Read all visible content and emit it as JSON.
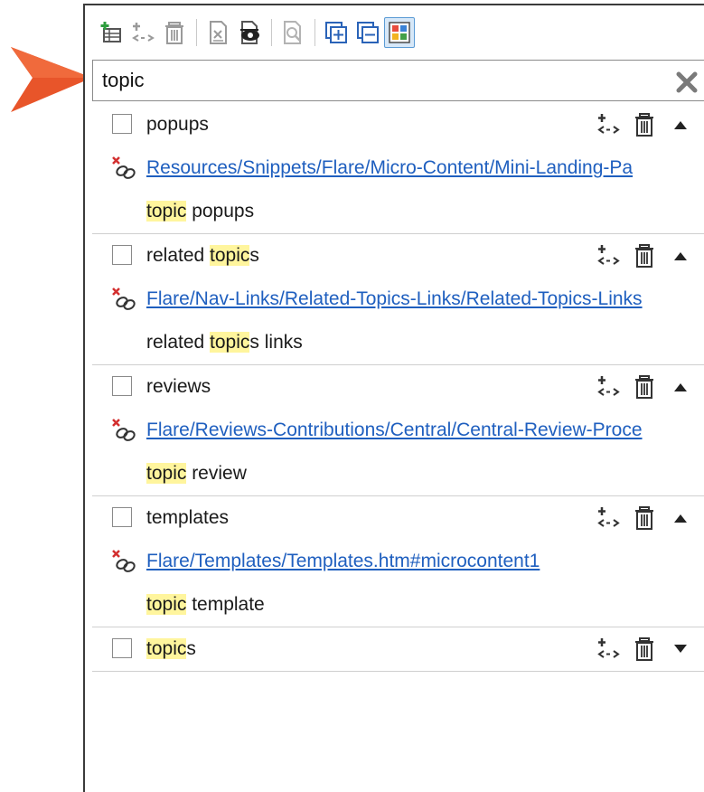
{
  "search": {
    "value": "topic",
    "placeholder": ""
  },
  "toolbar": {
    "icons": [
      "add-term-icon",
      "add-link-icon",
      "delete-icon",
      "export-icon",
      "preview-icon",
      "find-icon",
      "expand-all-icon",
      "collapse-all-icon",
      "view-grid-icon"
    ]
  },
  "colors": {
    "highlight": "#fff59d",
    "link": "#1f5fbf",
    "arrow": "#e8552a",
    "broken": "#d32f2f"
  },
  "entries": [
    {
      "pre": "",
      "hl": "",
      "post": "popups",
      "link": "Resources/Snippets/Flare/Micro-Content/Mini-Landing-Pa",
      "def_pre": "",
      "def_hl": "topic",
      "def_post": " popups",
      "arrow": "up"
    },
    {
      "pre": "related ",
      "hl": "topic",
      "post": "s",
      "link": "Flare/Nav-Links/Related-Topics-Links/Related-Topics-Links",
      "def_pre": "related ",
      "def_hl": "topic",
      "def_post": "s links",
      "arrow": "up"
    },
    {
      "pre": "",
      "hl": "",
      "post": "reviews",
      "link": "Flare/Reviews-Contributions/Central/Central-Review-Proce",
      "def_pre": "",
      "def_hl": "topic",
      "def_post": " review",
      "arrow": "up"
    },
    {
      "pre": "",
      "hl": "",
      "post": "templates",
      "link": "Flare/Templates/Templates.htm#microcontent1",
      "def_pre": "",
      "def_hl": "topic",
      "def_post": " template",
      "arrow": "up"
    },
    {
      "pre": "",
      "hl": "topic",
      "post": "s",
      "link": "",
      "def_pre": "",
      "def_hl": "",
      "def_post": "",
      "arrow": "down"
    }
  ]
}
